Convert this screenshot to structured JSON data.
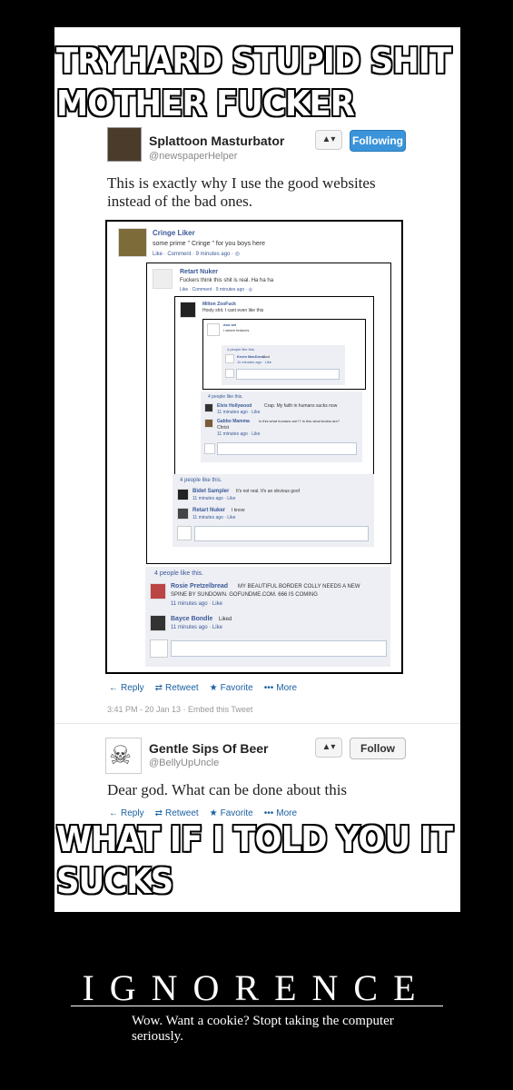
{
  "top_caption": {
    "line1": "TRYHARD STUPID SHIT",
    "line2": "MOTHER FUCKER"
  },
  "bottom_caption": {
    "line1": "WHAT IF I TOLD YOU IT",
    "line2": "SUCKS"
  },
  "poster": {
    "title": "IGNORENCE",
    "subtitle": "Wow. Want a cookie? Stopt taking the computer seriously."
  },
  "tweet1": {
    "name": "Splattoon Masturbator",
    "handle": "@newspaperHelper",
    "text_line1": "This is exactly why I use the good websites",
    "text_line2": "instead of the bad ones.",
    "follow_label": "Following",
    "person_label": "▲▾",
    "actions": {
      "reply": "Reply",
      "retweet": "Retweet",
      "favorite": "Favorite",
      "more": "More"
    },
    "timestamp": "3:41 PM - 20 Jan 13 · Embed this Tweet"
  },
  "tweet2": {
    "name": "Gentle Sips Of Beer",
    "handle": "@BellyUpUncle",
    "text": "Dear god. What can be done about this",
    "follow_label": "Follow",
    "actions": {
      "reply": "Reply",
      "retweet": "Retweet",
      "favorite": "Favorite",
      "more": "More"
    }
  },
  "fb": {
    "c1": {
      "name": "Cringe Liker",
      "text": "some prime \" Cringe \" for you boys here",
      "meta": "Like · Comment · 9 minutes ago · ◎"
    },
    "c2": {
      "name": "Retart Nuker",
      "text": "Fuckers think this shit is real. Ha ha ha",
      "meta": "Like · Comment · 9 minutes ago · ◎"
    },
    "c3": {
      "name": "Milton ZooFuck",
      "text": "Hooly shit. I cant even like this"
    },
    "c4": {
      "name": "doo wit",
      "text": "I where fedora's"
    },
    "c5": {
      "likes": "4 people like this.",
      "name": "Kevin MacDonal",
      "text": "Cool",
      "meta": "11 minutes ago · Like"
    },
    "c6": {
      "likes": "4 people like this.",
      "r1_name": "Elvis Hollywood",
      "r1_text": "Crap. My faith in humans sucks now",
      "r1_meta": "11 minutes ago · Like",
      "r2_name": "Gabbo Mamma",
      "r2_text": "Is this what humans are?? Is this what brains are?",
      "r2_text2": "Christ",
      "r2_meta": "11 minutes ago · Like"
    },
    "c7": {
      "likes": "4 people like this.",
      "r1_name": "Bidet Sampler",
      "r1_text": "It's not real. It's an obvious goof",
      "r1_meta": "11 minutes ago · Like",
      "r2_name": "Retart Nuker",
      "r2_text": "I know",
      "r2_meta": "11 minutes ago · Like"
    },
    "c8": {
      "likes": "4 people like this.",
      "r1_name": "Rosie Pretzelbread",
      "r1_text": "MY BEAUTIFUL BORDER COLLY NEEDS A NEW",
      "r1_text2": "SPINE BY SUNDOWN. GOFUNDME.COM. 666 IS COMING",
      "r1_meta": "11 minutes ago · Like",
      "r2_name": "Bayce Bondle",
      "r2_text": "Liked",
      "r2_meta": "11 minutes ago · Like"
    }
  }
}
